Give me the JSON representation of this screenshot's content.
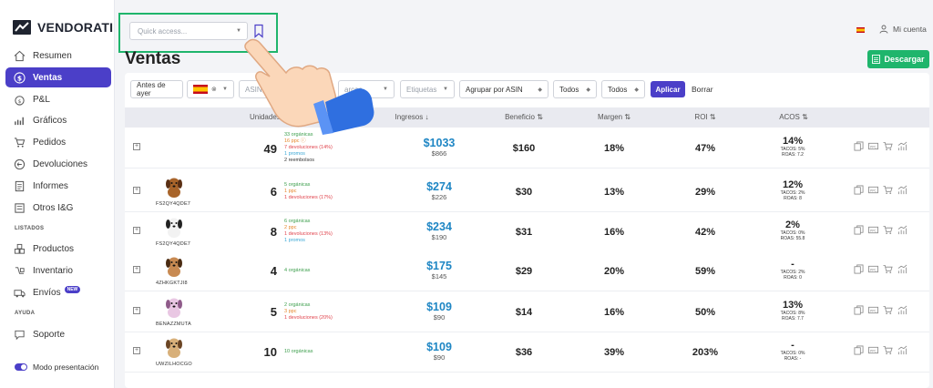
{
  "brand": {
    "name": "VENDORATI"
  },
  "sidebar": {
    "items": [
      {
        "label": "Resumen",
        "icon": "home-icon"
      },
      {
        "label": "Ventas",
        "icon": "dollar-circle-icon",
        "active": true
      },
      {
        "label": "P&L",
        "icon": "money-bag-icon"
      },
      {
        "label": "Gráficos",
        "icon": "bar-chart-icon"
      },
      {
        "label": "Pedidos",
        "icon": "cart-icon"
      },
      {
        "label": "Devoluciones",
        "icon": "return-icon"
      },
      {
        "label": "Informes",
        "icon": "report-icon"
      },
      {
        "label": "Otros I&G",
        "icon": "ledger-icon"
      }
    ],
    "section_listados": "LISTADOS",
    "items2": [
      {
        "label": "Productos",
        "icon": "boxes-icon"
      },
      {
        "label": "Inventario",
        "icon": "inventory-icon"
      },
      {
        "label": "Envíos",
        "icon": "truck-icon",
        "badge": "NEW"
      }
    ],
    "section_ayuda": "AYUDA",
    "items3": [
      {
        "label": "Soporte",
        "icon": "chat-icon"
      }
    ],
    "presentation_toggle": "Modo presentación"
  },
  "topbar": {
    "quick_access_placeholder": "Quick access...",
    "account_label": "Mi cuenta",
    "download_label": "Descargar"
  },
  "page": {
    "title": "Ventas"
  },
  "filters": {
    "period": "Antes de ayer",
    "asin_placeholder": "ASIN, S",
    "brands_placeholder": "arcas",
    "tags_placeholder": "Etiquetas",
    "group_by": "Agrupar por ASIN",
    "todos_1": "Todos",
    "todos_2": "Todos",
    "apply_label": "Aplicar",
    "clear_label": "Borrar"
  },
  "table": {
    "headers": {
      "units": "Unidades vendidas",
      "revenue": "Ingresos ↓",
      "profit": "Beneficio ⇅",
      "margin": "Margen ⇅",
      "roi": "ROI ⇅",
      "acos": "ACOS ⇅"
    },
    "rows": [
      {
        "sku": "",
        "units": "49",
        "breakdown": {
          "org": "33 orgánicas",
          "ppc": "16 ppc ⓘ",
          "dev": "7 devoluciones (14%)",
          "pro": "1 promos",
          "ref": "2 reembolsos"
        },
        "revenue": "$1033",
        "revenue_sub": "$866",
        "profit": "$160",
        "margin": "18%",
        "roi": "47%",
        "acos": "14%",
        "tacos": "TACOS: 5%",
        "roas": "ROAS: 7.2"
      },
      {
        "sku": "FS2QY4QDE7",
        "units": "6",
        "breakdown": {
          "org": "5 orgánicas",
          "ppc": "1 ppc",
          "dev": "1 devoluciones (17%)",
          "pro": "",
          "ref": ""
        },
        "revenue": "$274",
        "revenue_sub": "$226",
        "profit": "$30",
        "margin": "13%",
        "roi": "29%",
        "acos": "12%",
        "tacos": "TACOS: 2%",
        "roas": "ROAS: 8"
      },
      {
        "sku": "FS2QY4QDE7",
        "units": "8",
        "breakdown": {
          "org": "6 orgánicas",
          "ppc": "2 ppc",
          "dev": "1 devoluciones (13%)",
          "pro": "1 promos",
          "ref": ""
        },
        "revenue": "$234",
        "revenue_sub": "$190",
        "profit": "$31",
        "margin": "16%",
        "roi": "42%",
        "acos": "2%",
        "tacos": "TACOS: 0%",
        "roas": "ROAS: 55.8"
      },
      {
        "sku": "4ZHKGKTJI8",
        "units": "4",
        "breakdown": {
          "org": "4 orgánicas",
          "ppc": "",
          "dev": "",
          "pro": "",
          "ref": ""
        },
        "revenue": "$175",
        "revenue_sub": "$145",
        "profit": "$29",
        "margin": "20%",
        "roi": "59%",
        "acos": "-",
        "tacos": "TACOS: 2%",
        "roas": "ROAS: 0"
      },
      {
        "sku": "BENAZZMUTA",
        "units": "5",
        "breakdown": {
          "org": "2 orgánicas",
          "ppc": "3 ppc",
          "dev": "1 devoluciones (20%)",
          "pro": "",
          "ref": ""
        },
        "revenue": "$109",
        "revenue_sub": "$90",
        "profit": "$14",
        "margin": "16%",
        "roi": "50%",
        "acos": "13%",
        "tacos": "TACOS: 8%",
        "roas": "ROAS: 7.7"
      },
      {
        "sku": "UWZILHOCGO",
        "units": "10",
        "breakdown": {
          "org": "10 orgánicas",
          "ppc": "",
          "dev": "",
          "pro": "",
          "ref": ""
        },
        "revenue": "$109",
        "revenue_sub": "$90",
        "profit": "$36",
        "margin": "39%",
        "roi": "203%",
        "acos": "-",
        "tacos": "TACOS: 0%",
        "roas": "ROAS: -"
      }
    ]
  },
  "colors": {
    "accent": "#4b3fc8",
    "green": "#1fb56c",
    "revenue_blue": "#1e86c4"
  }
}
